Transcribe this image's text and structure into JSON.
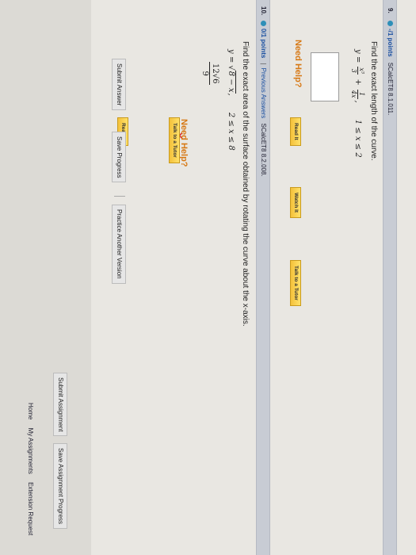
{
  "q9": {
    "number": "9.",
    "points": "-/1 points",
    "source": "SCalcET8 8.1.011.",
    "question": "Find the exact length of the curve.",
    "eq_lhs": "y =",
    "frac1_num": "x³",
    "frac1_den": "3",
    "plus": "+",
    "frac2_num": "1",
    "frac2_den": "4x",
    "comma": ",",
    "range": "1 ≤ x ≤ 2",
    "help_label": "Need Help?",
    "read_it": "Read It",
    "watch_it": "Watch It",
    "talk_tutor": "Talk to a Tutor"
  },
  "q10": {
    "number": "10.",
    "points": "0/1 points",
    "pipe": "|",
    "previous_answers": "Previous Answers",
    "source": "SCalcET8 8.2.008.",
    "question": "Find the exact area of the surface obtained by rotating the curve about the x-axis.",
    "eq_lhs": "y =",
    "sqrt_sym": "√",
    "sqrt_body": "8 − x",
    "comma": ",",
    "range": "2 ≤ x ≤ 8",
    "answer_num": "12√6",
    "answer_den": "9",
    "mark": "✕",
    "help_label": "Need Help?",
    "read_it": "Read It",
    "talk_tutor": "Talk to a Tutor",
    "submit_answer": "Submit Answer",
    "save_progress": "Save Progress",
    "practice_another": "Practice Another Version"
  },
  "footer": {
    "submit_assignment": "Submit Assignment",
    "save_assignment_progress": "Save Assignment Progress",
    "home": "Home",
    "my_assignments": "My Assignments",
    "extension_request": "Extension Request"
  }
}
